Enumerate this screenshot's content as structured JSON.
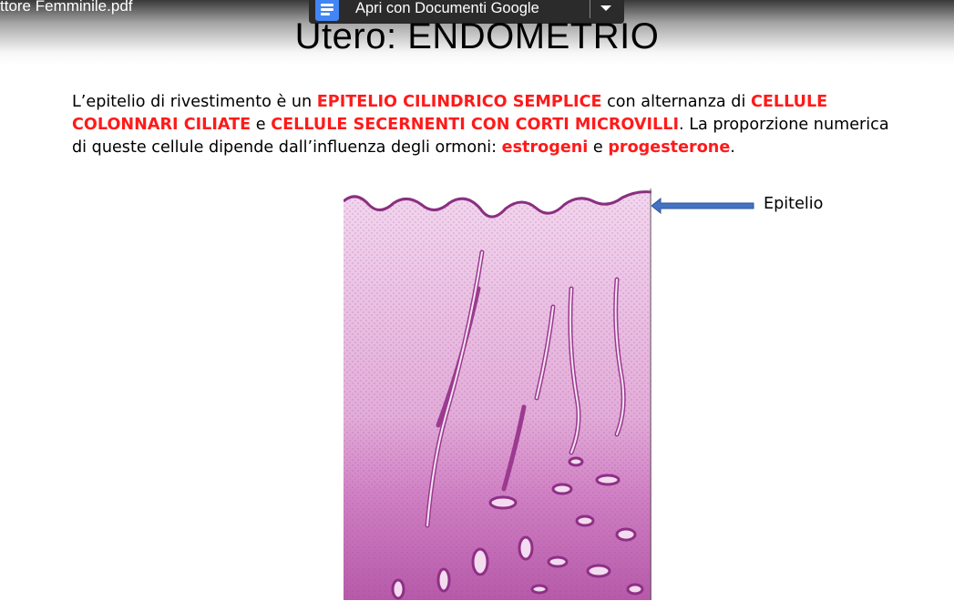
{
  "overlay": {
    "filename": "ttore Femminile.pdf",
    "open_button_label": "Apri con Documenti Google"
  },
  "slide": {
    "title": "Utero: ENDOMETRIO",
    "paragraph": {
      "p1": "L’epitelio di rivestimento è un ",
      "r1": "EPITELIO CILINDRICO SEMPLICE",
      "p2": " con alternanza di ",
      "r2": "CELLULE COLONNARI CILIATE",
      "p3": " e ",
      "r3": "CELLULE SECERNENTI CON CORTI MICROVILLI",
      "p4": ". La proporzione numerica di queste cellule dipende dall’influenza degli ormoni: ",
      "r4": "estrogeni",
      "p5": " e ",
      "r5": "progesterone",
      "p6": "."
    },
    "annotation_label": "Epitelio"
  },
  "colors": {
    "highlight_red": "#ff1a1a",
    "arrow_blue": "#4472c4",
    "tissue_pink": "#e8b6df",
    "tissue_purple": "#b54aa8",
    "docs_blue": "#4285f4"
  }
}
